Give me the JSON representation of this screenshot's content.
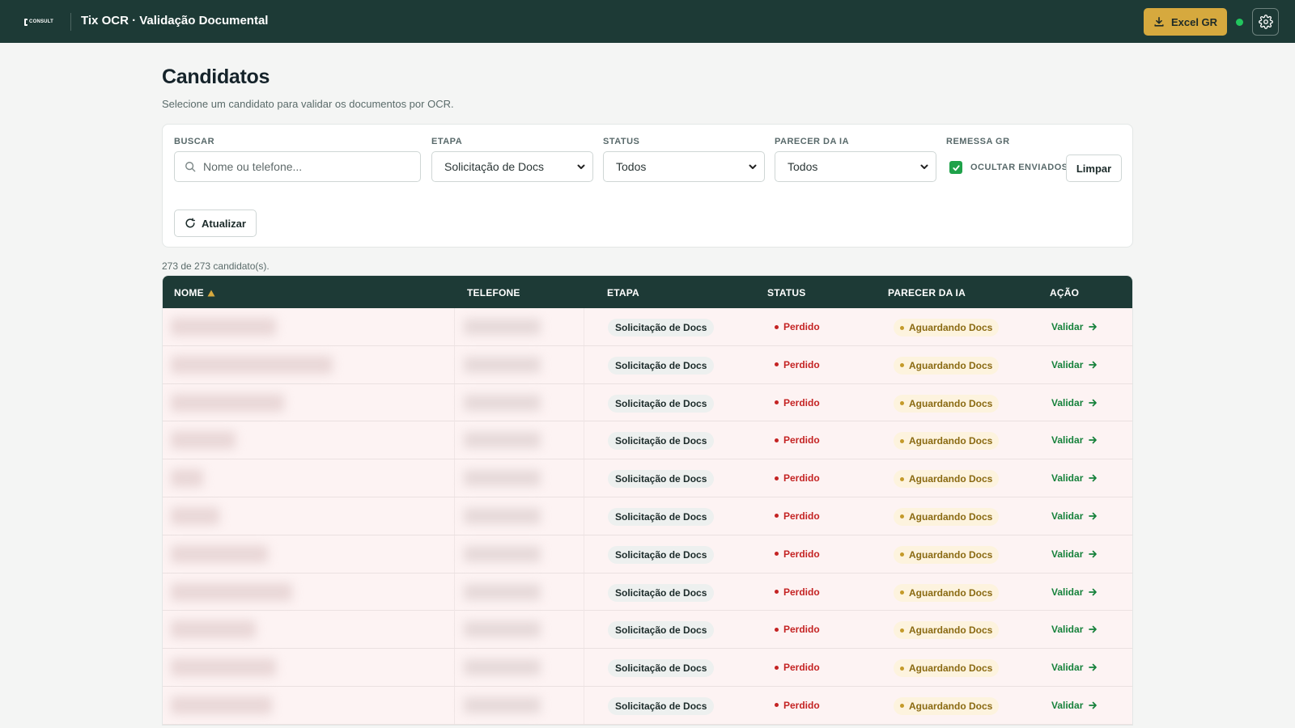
{
  "header": {
    "logo_text": "CONSULT",
    "app_title": "Tix OCR · Validação Documental",
    "excel_label": "Excel GR"
  },
  "page": {
    "title": "Candidatos",
    "subtitle": "Selecione um candidato para validar os documentos por OCR."
  },
  "filters": {
    "buscar_label": "BUSCAR",
    "buscar_placeholder": "Nome ou telefone...",
    "etapa_label": "ETAPA",
    "etapa_value": "Solicitação de Docs",
    "status_label": "STATUS",
    "status_value": "Todos",
    "parecer_label": "PARECER DA IA",
    "parecer_value": "Todos",
    "remessa_label": "REMESSA GR",
    "ocultar_label": "OCULTAR ENVIADOS",
    "ocultar_checked": true,
    "limpar_label": "Limpar",
    "atualizar_label": "Atualizar"
  },
  "count_text": "273 de 273 candidato(s).",
  "table": {
    "columns": [
      "NOME",
      "TELEFONE",
      "ETAPA",
      "STATUS",
      "PARECER DA IA",
      "AÇÃO"
    ],
    "rows": [
      {
        "etapa": "Solicitação de Docs",
        "status": "Perdido",
        "parecer": "Aguardando Docs",
        "acao": "Validar"
      },
      {
        "etapa": "Solicitação de Docs",
        "status": "Perdido",
        "parecer": "Aguardando Docs",
        "acao": "Validar"
      },
      {
        "etapa": "Solicitação de Docs",
        "status": "Perdido",
        "parecer": "Aguardando Docs",
        "acao": "Validar"
      },
      {
        "etapa": "Solicitação de Docs",
        "status": "Perdido",
        "parecer": "Aguardando Docs",
        "acao": "Validar"
      },
      {
        "etapa": "Solicitação de Docs",
        "status": "Perdido",
        "parecer": "Aguardando Docs",
        "acao": "Validar"
      },
      {
        "etapa": "Solicitação de Docs",
        "status": "Perdido",
        "parecer": "Aguardando Docs",
        "acao": "Validar"
      },
      {
        "etapa": "Solicitação de Docs",
        "status": "Perdido",
        "parecer": "Aguardando Docs",
        "acao": "Validar"
      },
      {
        "etapa": "Solicitação de Docs",
        "status": "Perdido",
        "parecer": "Aguardando Docs",
        "acao": "Validar"
      },
      {
        "etapa": "Solicitação de Docs",
        "status": "Perdido",
        "parecer": "Aguardando Docs",
        "acao": "Validar"
      },
      {
        "etapa": "Solicitação de Docs",
        "status": "Perdido",
        "parecer": "Aguardando Docs",
        "acao": "Validar"
      },
      {
        "etapa": "Solicitação de Docs",
        "status": "Perdido",
        "parecer": "Aguardando Docs",
        "acao": "Validar"
      }
    ]
  },
  "colors": {
    "header_bg": "#1d3a36",
    "accent": "#d6a93e",
    "status_red": "#c42323",
    "validar_green": "#16813b",
    "online_dot": "#22c55e"
  },
  "icons": [
    "download-icon",
    "gear-icon",
    "search-icon",
    "refresh-icon",
    "sort-asc-icon",
    "arrow-right-icon",
    "chevron-down-icon",
    "check-icon"
  ]
}
